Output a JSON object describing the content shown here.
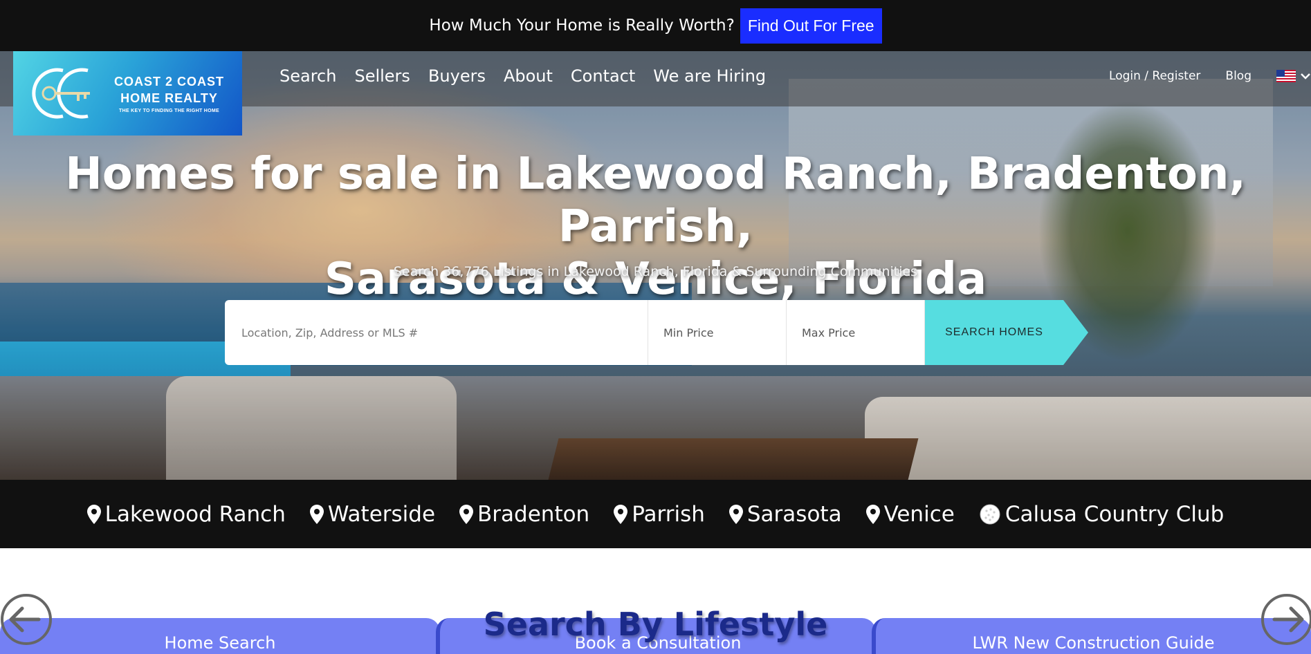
{
  "promo": {
    "text": "How Much Your Home is Really Worth?",
    "button": "Find Out For Free"
  },
  "logo": {
    "line1": "COAST 2 COAST",
    "line2": "HOME REALTY",
    "tagline": "THE KEY TO FINDING THE RIGHT HOME",
    "colors": {
      "start": "#52d4e4",
      "end": "#1256c8"
    }
  },
  "nav": {
    "items": [
      "Search",
      "Sellers",
      "Buyers",
      "About",
      "Contact",
      "We are Hiring"
    ],
    "login": "Login / Register",
    "blog": "Blog",
    "language_icon": "us-flag-icon"
  },
  "hero": {
    "title_line1": "Homes for sale in Lakewood Ranch, Bradenton, Parrish,",
    "title_line2": "Sarasota & Venice, Florida",
    "subtitle": "Search 36,776 Listings in Lakewood Ranch, Florida & Surrounding Communities"
  },
  "search": {
    "location_placeholder": "Location, Zip, Address or MLS #",
    "min_price": "Min Price",
    "max_price": "Max Price",
    "button": "SEARCH HOMES",
    "button_color": "#56dde0"
  },
  "cities": {
    "items": [
      "Lakewood Ranch",
      "Waterside",
      "Bradenton",
      "Parrish",
      "Sarasota",
      "Venice",
      "Calusa Country Club"
    ],
    "icons": [
      "map-pin-icon",
      "map-pin-icon",
      "map-pin-icon",
      "map-pin-icon",
      "map-pin-icon",
      "map-pin-icon",
      "golf-ball-icon"
    ]
  },
  "lifestyle": {
    "heading": "Search By Lifestyle",
    "cards": [
      "Home Search",
      "Book a Consultation",
      "LWR New Construction Guide"
    ],
    "card_color": "#7480f4"
  },
  "colors": {
    "promo_button": "#1a2dff",
    "dark_bar": "#111111",
    "lifestyle_heading": "#1b2a8a"
  }
}
